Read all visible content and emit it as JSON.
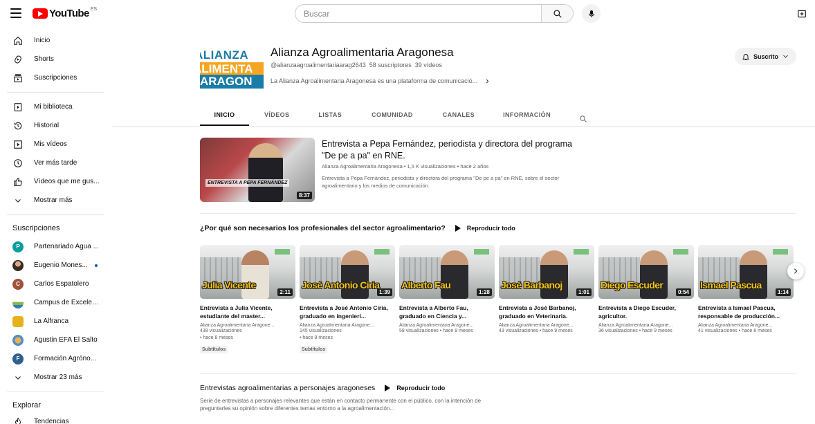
{
  "header": {
    "logo_text": "YouTube",
    "logo_country": "ES",
    "search_placeholder": "Buscar"
  },
  "sidebar": {
    "main": [
      {
        "label": "Inicio",
        "icon": "home-icon"
      },
      {
        "label": "Shorts",
        "icon": "shorts-icon"
      },
      {
        "label": "Suscripciones",
        "icon": "subscriptions-icon"
      }
    ],
    "library": [
      {
        "label": "Mi biblioteca",
        "icon": "library-icon"
      },
      {
        "label": "Historial",
        "icon": "history-icon"
      },
      {
        "label": "Mis vídeos",
        "icon": "my-videos-icon"
      },
      {
        "label": "Ver más tarde",
        "icon": "watch-later-icon"
      },
      {
        "label": "Vídeos que me gus...",
        "icon": "like-icon"
      },
      {
        "label": "Mostrar más",
        "icon": "chevron-down-icon"
      }
    ],
    "subscriptions_heading": "Suscripciones",
    "subscriptions": [
      {
        "label": "Partenariado Agua ...",
        "avatar": "P",
        "color": "#0b9e9e"
      },
      {
        "label": "Eugenio Mones...",
        "avatar": "",
        "color": "#3b2a22",
        "new": true
      },
      {
        "label": "Carlos Espatolero",
        "avatar": "C",
        "color": "#a0523a"
      },
      {
        "label": "Campus de Excelen...",
        "avatar": "",
        "color": "#8ab64a"
      },
      {
        "label": "La Alfranca",
        "avatar": "",
        "color": "#e3b21c"
      },
      {
        "label": "Agustin EFA El Salto",
        "avatar": "",
        "color": "#e08a3a"
      },
      {
        "label": "Formación Agróno...",
        "avatar": "F",
        "color": "#2e5f8f"
      },
      {
        "label": "Mostrar 23 más",
        "avatar": "",
        "color": ""
      }
    ],
    "explore_heading": "Explorar",
    "explore": [
      {
        "label": "Tendencias",
        "icon": "trending-icon"
      }
    ]
  },
  "channel": {
    "logo_lines": [
      "ALIANZA",
      "ALIMENTA",
      "ARAGON"
    ],
    "name": "Alianza Agroalimentaria Aragonesa",
    "handle": "@alianzaagroalimentariaarag2643",
    "subscribers": "58 suscriptores",
    "videos": "39 vídeos",
    "description": "La Alianza Agroalimentaria Aragonesa es una plataforma de comunicació...",
    "subscribe_label": "Suscrito"
  },
  "tabs": [
    "INICIO",
    "VÍDEOS",
    "LISTAS",
    "COMUNIDAD",
    "CANALES",
    "INFORMACIÓN"
  ],
  "featured": {
    "title": "Entrevista a Pepa Fernández, periodista y directora del programa \"De pe a pa\" en RNE.",
    "meta": "Alianza Agroalimentaria Aragonesa • 1,5 K visualizaciones • hace 2 años",
    "description": "Entrevista a Pepa Fernández, periodista y directora del programa \"De pe a pa\" en RNE, sobre el sector agroalimentario y los medios de comunicación.",
    "duration": "8:37",
    "thumb_caption": "ENTREVISTA A PEPA FERNÁNDEZ"
  },
  "shelf1": {
    "title": "¿Por qué son necesarios los profesionales del sector agroalimentario?",
    "play_all": "Reproducir todo",
    "videos": [
      {
        "overlay": "Julia Vicente",
        "duration": "2:11",
        "title": "Entrevista a Julia Vicente, estudiante del master...",
        "channel": "Alianza Agroalimentaria Aragone...",
        "views": "438 visualizaciones",
        "age": "• hace 8 meses",
        "badge": "Subtítulos"
      },
      {
        "overlay": "José Antonio Ciria",
        "duration": "1:39",
        "title": "Entrevista a José Antonio Ciria, graduado en ingenierí...",
        "channel": "Alianza Agroalimentaria Aragone...",
        "views": "145 visualizaciones",
        "age": "• hace 9 meses",
        "badge": "Subtítulos"
      },
      {
        "overlay": "Alberto Fau",
        "duration": "1:28",
        "title": "Entrevista a Alberto Fau, graduado en Ciencia y...",
        "channel": "Alianza Agroalimentaria Aragone...",
        "views": "58 visualizaciones • hace 9 meses",
        "age": "",
        "badge": ""
      },
      {
        "overlay": "José Barbanoj",
        "duration": "1:01",
        "title": "Entrevista a José Barbanoj, graduado en Veterinaria.",
        "channel": "Alianza Agroalimentaria Aragone...",
        "views": "43 visualizaciones • hace 9 meses",
        "age": "",
        "badge": ""
      },
      {
        "overlay": "Diego Escuder",
        "duration": "0:54",
        "title": "Entrevista a Diego Escuder, agricultor.",
        "channel": "Alianza Agroalimentaria Aragone...",
        "views": "36 visualizaciones • hace 9 meses",
        "age": "",
        "badge": ""
      },
      {
        "overlay": "Ismael Pascua",
        "duration": "1:14",
        "title": "Entrevista a Ismael Pascua, responsable de producción...",
        "channel": "Alianza Agroalimentaria Aragone...",
        "views": "41 visualizaciones • hace 8 meses",
        "age": "",
        "badge": ""
      }
    ]
  },
  "shelf2": {
    "title": "Entrevistas agroalimentarias a personajes aragoneses",
    "play_all": "Reproducir todo",
    "description": "Serie de entrevistas a personajes relevantes que están en contacto permanente con el público, con la intención de preguntarles su opinión sobre diferentes temas entorno a la agroalimentación..."
  }
}
